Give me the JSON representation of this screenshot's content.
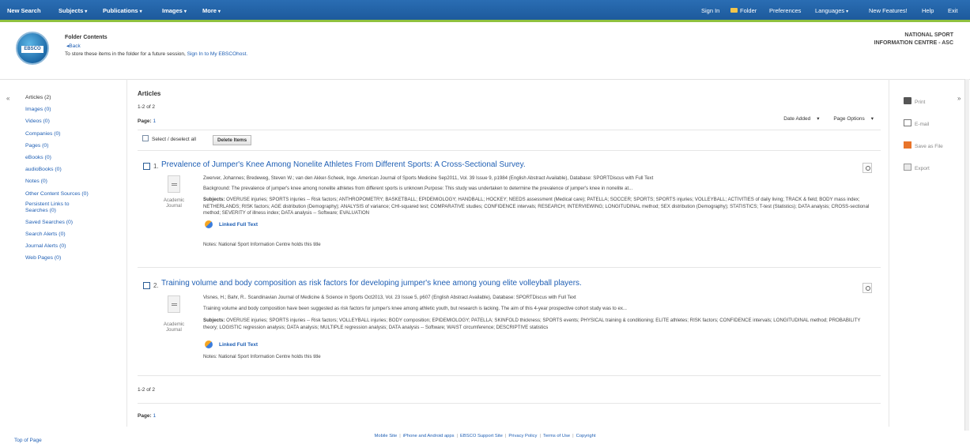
{
  "topbar": {
    "left": [
      {
        "label": "New Search",
        "caret": false
      },
      {
        "label": "Subjects",
        "caret": true
      },
      {
        "label": "Publications",
        "caret": true
      },
      {
        "label": "Images",
        "caret": true
      },
      {
        "label": "More",
        "caret": true
      }
    ],
    "right": {
      "sign_in": "Sign In",
      "folder": "Folder",
      "preferences": "Preferences",
      "languages": "Languages",
      "new_features": "New Features!",
      "help": "Help",
      "exit": "Exit"
    }
  },
  "header": {
    "logo_text": "EBSCO",
    "title": "Folder Contents",
    "back": "Back",
    "note_prefix": "To store these items in the folder for a future session,",
    "note_link": "Sign In to My EBSCOhost.",
    "institution_line1": "NATIONAL SPORT",
    "institution_line2": "INFORMATION CENTRE - ASC"
  },
  "sidebar": {
    "items": [
      {
        "label": "Articles (2)",
        "current": true
      },
      {
        "label": "Images (0)"
      },
      {
        "label": "Videos (0)"
      },
      {
        "label": "Companies (0)"
      },
      {
        "label": "Pages (0)"
      },
      {
        "label": "eBooks (0)"
      },
      {
        "label": "audioBooks (0)"
      },
      {
        "label": "Notes (0)"
      },
      {
        "label": "Other Content Sources (0)"
      },
      {
        "label": "Persistent Links to Searches (0)",
        "wrap": true
      },
      {
        "label": "Saved Searches (0)"
      },
      {
        "label": "Search Alerts (0)"
      },
      {
        "label": "Journal Alerts (0)"
      },
      {
        "label": "Web Pages (0)"
      }
    ]
  },
  "main": {
    "heading": "Articles",
    "count": "1-2 of 2",
    "page_label": "Page:",
    "page_number": "1",
    "date_added": "Date Added",
    "page_options": "Page Options",
    "select_all": "Select / deselect all",
    "delete_items": "Delete Items",
    "results": [
      {
        "number": "1.",
        "title": "Prevalence of Jumper's Knee Among Nonelite Athletes From Different Sports: A Cross-Sectional Survey.",
        "citation": "Zwerver, Johannes; Bredeweg, Steven W.; van den Akker-Scheek, Inge. American Journal of Sports Medicine Sep2011, Vol. 39 Issue 9, p1984 (English Abstract Available), Database: SPORTDiscus with Full Text",
        "abstract": "Background: The prevalence of jumper's knee among nonelite athletes from different sports is unknown.Purpose: This study was undertaken to determine the prevalence of jumper's knee in nonelite at...",
        "subjects_label": "Subjects:",
        "subjects": "OVERUSE injuries; SPORTS injuries -- Risk factors; ANTHROPOMETRY; BASKETBALL; EPIDEMIOLOGY; HANDBALL; HOCKEY; NEEDS assessment (Medical care); PATELLA; SOCCER; SPORTS; SPORTS injuries; VOLLEYBALL; ACTIVITIES of daily living; TRACK & field; BODY mass index; NETHERLANDS; RISK factors; AGE distribution (Demography); ANALYSIS of variance; CHI-squared test; COMPARATIVE studies; CONFIDENCE intervals; RESEARCH; INTERVIEWING; LONGITUDINAL method; SEX distribution (Demography); STATISTICS; T-test (Statistics); DATA analysis; CROSS-sectional method; SEVERITY of illness index; DATA analysis -- Software; EVALUATION",
        "pub_type_1": "Academic",
        "pub_type_2": "Journal",
        "full_text": "Linked Full Text",
        "notes": "Notes:  National Sport Information Centre holds this title"
      },
      {
        "number": "2.",
        "title": "Training volume and body composition as risk factors for developing jumper's knee among young elite volleyball players.",
        "citation": "Visnes, H.; Bahr, R.. Scandinavian Journal of Medicine & Science in Sports Oct2013, Vol. 23 Issue 5, p607 (English Abstract Available), Database: SPORTDiscus with Full Text",
        "abstract": "Training volume and body composition have been suggested as risk factors for jumper's knee among athletic youth, but research is lacking. The aim of this 4-year prospective cohort study was to ex...",
        "subjects_label": "Subjects:",
        "subjects": "OVERUSE injuries; SPORTS injuries -- Risk factors; VOLLEYBALL injuries; BODY composition; EPIDEMIOLOGY; PATELLA; SKINFOLD thickness; SPORTS events; PHYSICAL training & conditioning; ELITE athletes; RISK factors; CONFIDENCE intervals; LONGITUDINAL method; PROBABILITY theory; LOGISTIC regression analysis; DATA analysis; MULTIPLE regression analysis; DATA analysis -- Software; WAIST circumference; DESCRIPTIVE statistics",
        "pub_type_1": "Academic",
        "pub_type_2": "Journal",
        "full_text": "Linked Full Text",
        "notes": "Notes:  National Sport Information Centre holds this title"
      }
    ]
  },
  "tools": {
    "print": "Print",
    "email": "E-mail",
    "save": "Save as File",
    "export": "Export"
  },
  "footer": {
    "top_of_page": "Top of Page",
    "links": [
      "Mobile Site",
      "iPhone and Android apps",
      "EBSCO Support Site",
      "Privacy Policy",
      "Terms of Use",
      "Copyright"
    ]
  },
  "colors": {
    "topbar": "#1d5a9c",
    "topbar_accent": "#8fc13f",
    "link": "#1f5fb4"
  }
}
